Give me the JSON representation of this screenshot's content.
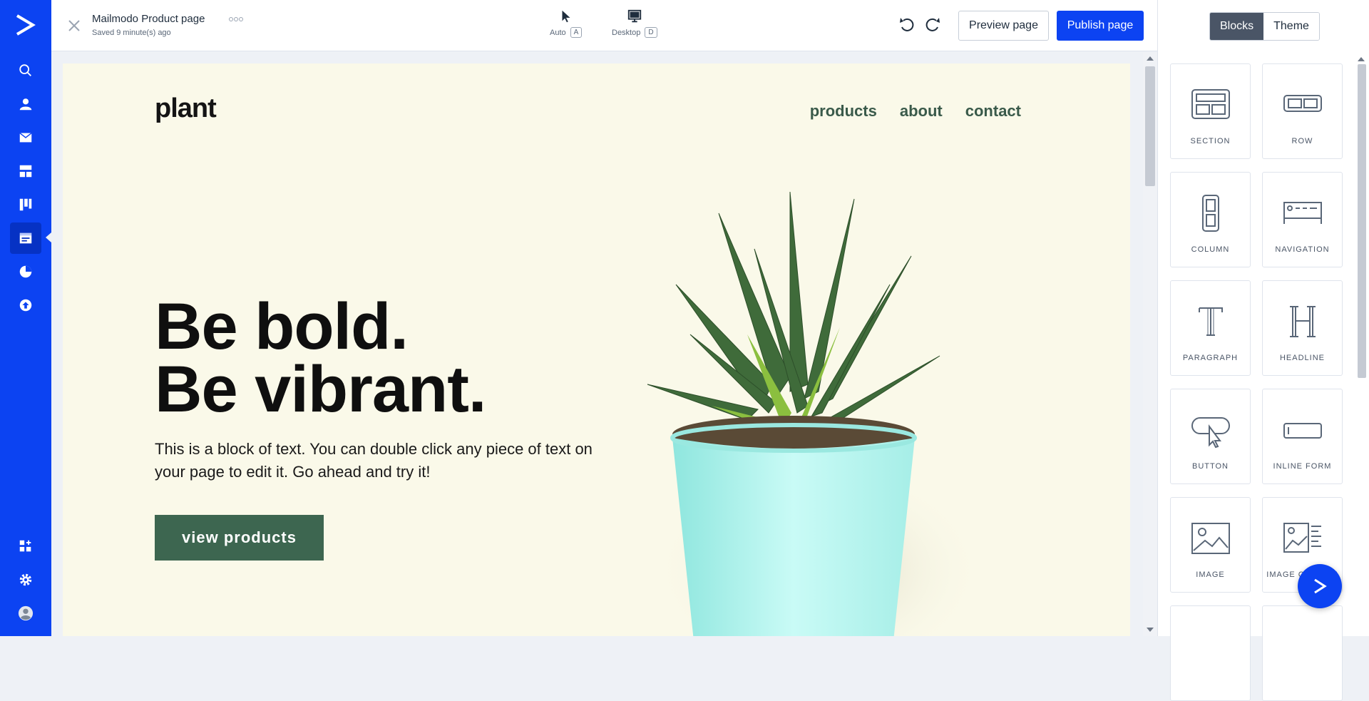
{
  "topbar": {
    "page_title": "Mailmodo Product page",
    "saved_status": "Saved 9 minute(s) ago",
    "mode_auto": {
      "label": "Auto",
      "key": "A"
    },
    "mode_desktop": {
      "label": "Desktop",
      "key": "D"
    },
    "preview_label": "Preview page",
    "publish_label": "Publish page"
  },
  "sidebar": {
    "items": [
      "search-icon",
      "contacts-icon",
      "campaigns-icon",
      "automations-icon",
      "deals-icon",
      "landing-pages-icon",
      "reports-icon",
      "upgrade-icon",
      "apps-icon",
      "settings-icon",
      "profile-icon"
    ],
    "active": "landing-pages-icon"
  },
  "canvas": {
    "brand": "plant",
    "nav": [
      "products",
      "about",
      "contact"
    ],
    "hero_line1": "Be bold.",
    "hero_line2": "Be vibrant.",
    "hero_text": "This is a block of text. You can double click any piece of text on your page to edit it. Go ahead and try it!",
    "cta_label": "view products"
  },
  "panel": {
    "tabs": [
      "Blocks",
      "Theme"
    ],
    "active_tab": "Blocks",
    "blocks": [
      {
        "label": "SECTION",
        "icon": "section-icon"
      },
      {
        "label": "ROW",
        "icon": "row-icon"
      },
      {
        "label": "COLUMN",
        "icon": "column-icon"
      },
      {
        "label": "NAVIGATION",
        "icon": "navigation-icon"
      },
      {
        "label": "PARAGRAPH",
        "icon": "paragraph-icon"
      },
      {
        "label": "HEADLINE",
        "icon": "headline-icon"
      },
      {
        "label": "BUTTON",
        "icon": "button-icon"
      },
      {
        "label": "INLINE FORM",
        "icon": "inline-form-icon"
      },
      {
        "label": "IMAGE",
        "icon": "image-icon"
      },
      {
        "label": "IMAGE CAPTION",
        "icon": "image-caption-icon"
      }
    ]
  },
  "colors": {
    "brand_blue": "#0c43f2",
    "canvas_bg": "#faf9e9",
    "cta_green": "#3d6650",
    "nav_green": "#3a5a4a"
  }
}
